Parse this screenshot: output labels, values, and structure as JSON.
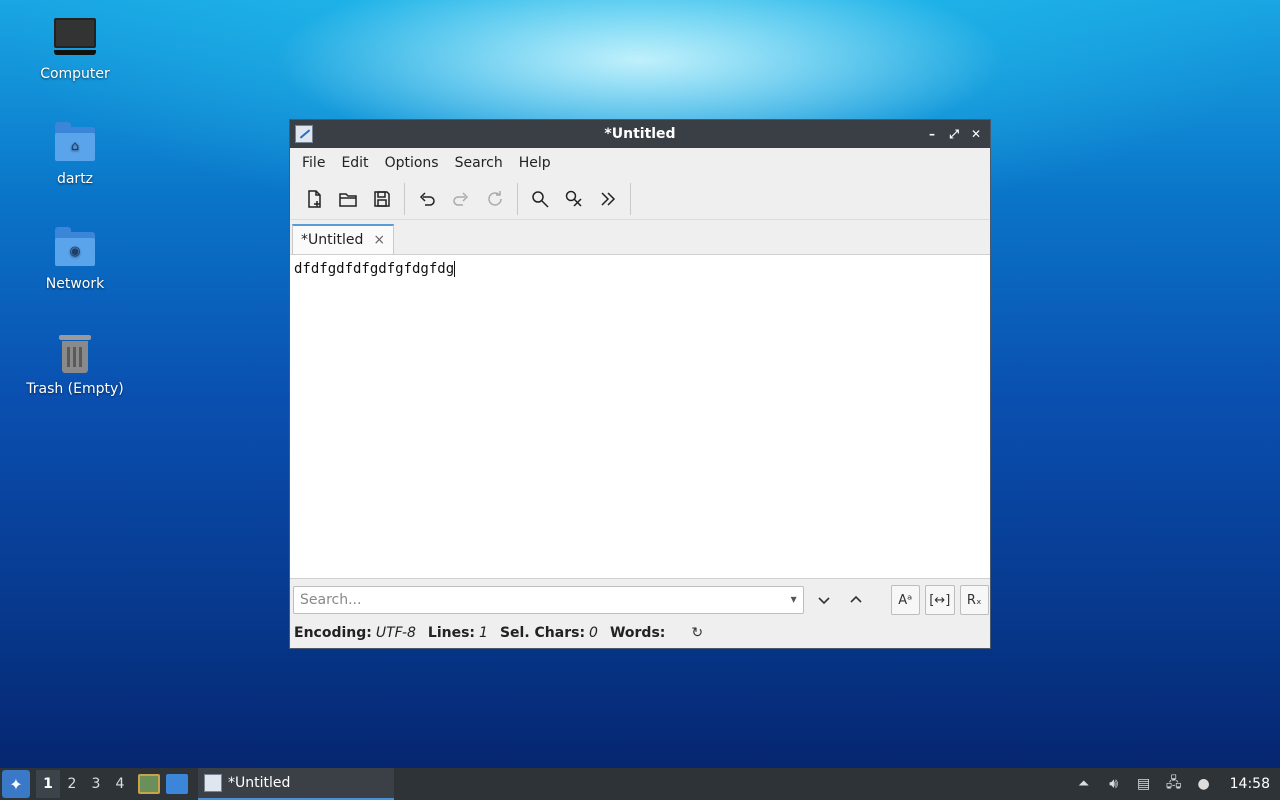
{
  "desktop": {
    "icons": [
      {
        "label": "Computer"
      },
      {
        "label": "dartz"
      },
      {
        "label": "Network"
      },
      {
        "label": "Trash (Empty)"
      }
    ]
  },
  "window": {
    "title": "*Untitled",
    "controls": {
      "minimize": "–",
      "maximize": "⤢",
      "close": "✕"
    }
  },
  "menubar": {
    "items": [
      "File",
      "Edit",
      "Options",
      "Search",
      "Help"
    ]
  },
  "toolbar": {
    "buttons": [
      "new-file",
      "open-file",
      "save-file",
      "undo",
      "redo",
      "reload",
      "find",
      "find-replace",
      "more"
    ]
  },
  "tabs": [
    {
      "label": "*Untitled",
      "close": "×"
    }
  ],
  "editor": {
    "content": "dfdfgdfdfgdfgfdgfdg"
  },
  "search": {
    "placeholder": "Search...",
    "value": "",
    "down": "⌄",
    "up": "⌃",
    "match_case_label": "Aᵃ",
    "whole_word_label": "[↔]",
    "regex_label": "Rₓ"
  },
  "status": {
    "encoding_label": "Encoding:",
    "encoding_value": "UTF-8",
    "lines_label": "Lines:",
    "lines_value": "1",
    "sel_label": "Sel. Chars:",
    "sel_value": "0",
    "words_label": "Words:",
    "words_value": ""
  },
  "taskbar": {
    "workspaces": [
      "1",
      "2",
      "3",
      "4"
    ],
    "active_workspace": "1",
    "task_title": "*Untitled",
    "clock": "14:58"
  },
  "colors": {
    "titlebar": "#3a3f45",
    "tab_accent": "#5b9bd5",
    "taskbar": "#2e3338"
  }
}
